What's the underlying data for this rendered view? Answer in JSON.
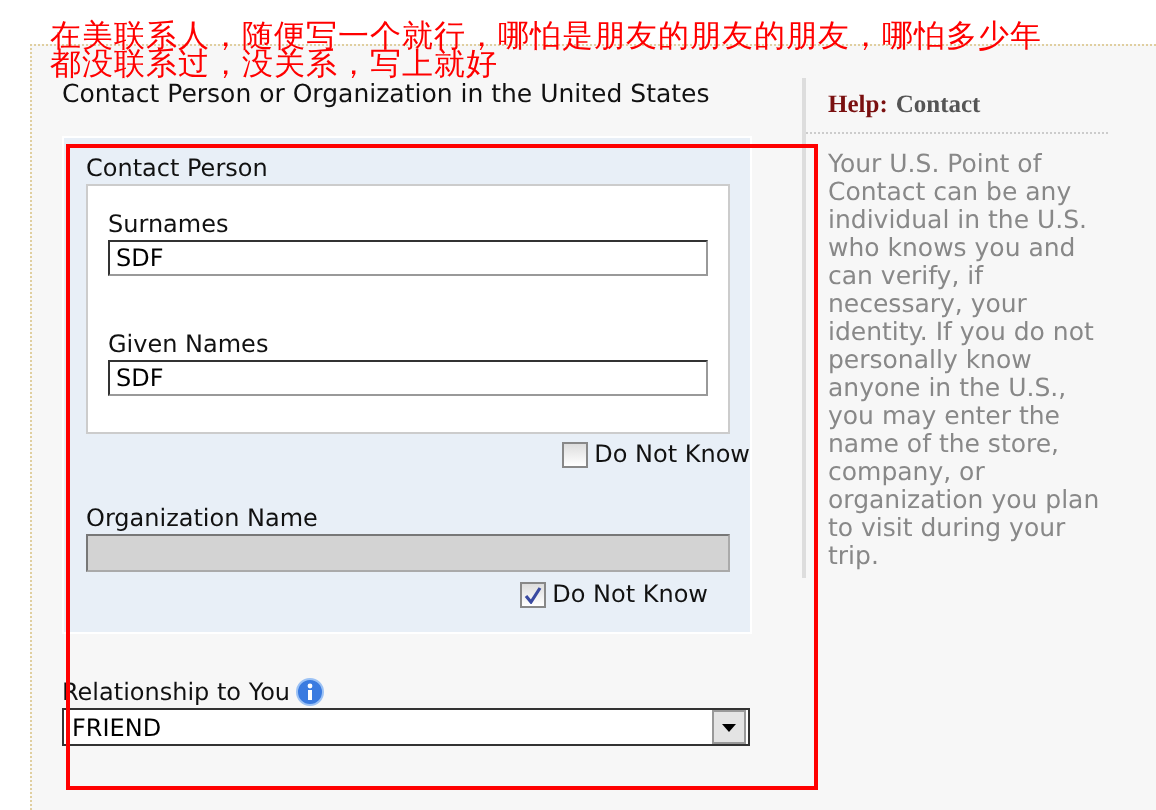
{
  "annotation": {
    "lines": [
      "在美联系人，随便写一个就行，哪怕是朋友的朋友的朋友，哪怕多少年",
      "都没联系过，没关系，写上就好"
    ]
  },
  "form": {
    "heading": "Contact Person or Organization in the United States",
    "contact_person": {
      "legend": "Contact Person",
      "fields": [
        {
          "label": "Surnames",
          "value": "SDF"
        },
        {
          "label": "Given Names",
          "value": "SDF"
        }
      ],
      "do_not_know": {
        "label": "Do Not Know",
        "checked": false
      }
    },
    "organization": {
      "label": "Organization Name",
      "disabled": true,
      "do_not_know": {
        "label": "Do Not Know",
        "checked": true
      }
    },
    "relationship": {
      "label": "Relationship to You",
      "value": "FRIEND"
    }
  },
  "help": {
    "prefix": "Help:",
    "title": "Contact",
    "text": "Your U.S. Point of Contact can be any individual in the U.S. who knows you and can verify, if necessary, your identity. If you do not personally know anyone in the U.S., you may enter the name of the store, company, or organization you plan to visit during your trip."
  }
}
